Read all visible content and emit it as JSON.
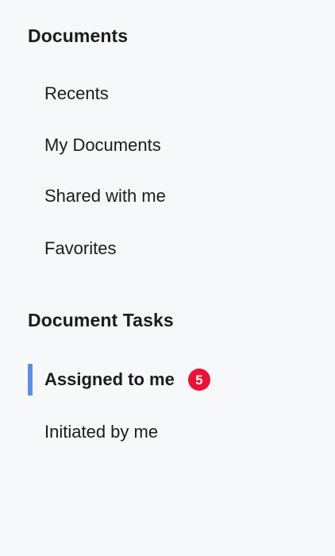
{
  "documents": {
    "title": "Documents",
    "items": [
      {
        "label": "Recents"
      },
      {
        "label": "My Documents"
      },
      {
        "label": "Shared with me"
      },
      {
        "label": "Favorites"
      }
    ]
  },
  "tasks": {
    "title": "Document Tasks",
    "items": [
      {
        "label": "Assigned to me",
        "badge": "5",
        "active": true
      },
      {
        "label": "Initiated by me"
      }
    ]
  },
  "colors": {
    "background": "#f7f8fa",
    "active_indicator": "#5b8fe3",
    "badge": "#ee1133"
  }
}
